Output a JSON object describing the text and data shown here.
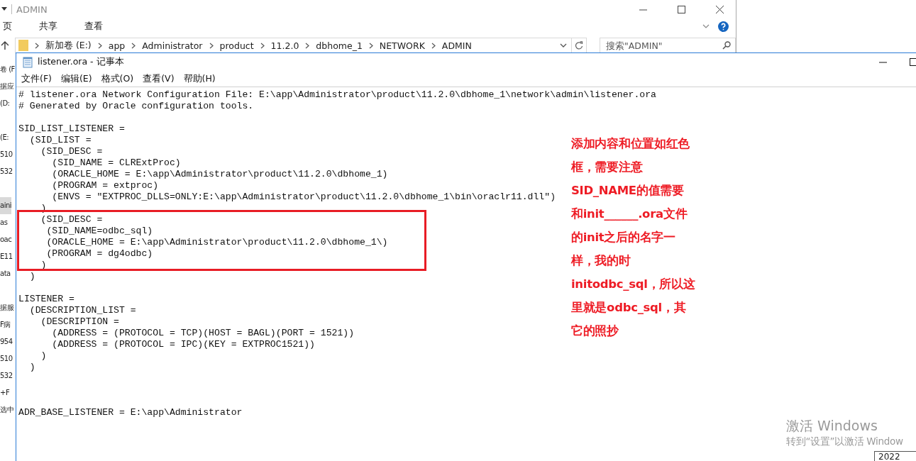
{
  "explorer": {
    "title": "ADMIN",
    "ribbon_tabs": [
      {
        "label": "页",
        "selected": false
      },
      {
        "label": "共享",
        "selected": false
      },
      {
        "label": "查看",
        "selected": false
      }
    ],
    "breadcrumbs": [
      "新加卷 (E:)",
      "app",
      "Administrator",
      "product",
      "11.2.0",
      "dbhome_1",
      "NETWORK",
      "ADMIN"
    ],
    "search": {
      "placeholder": "搜索\"ADMIN\""
    },
    "nav_items": [
      {
        "kind": "item",
        "label": "卷 (F",
        "selected": false
      },
      {
        "kind": "item",
        "label": "据应",
        "selected": false
      },
      {
        "kind": "item",
        "label": "(D:",
        "selected": false
      },
      {
        "kind": "blank"
      },
      {
        "kind": "item",
        "label": "(E:",
        "selected": false
      },
      {
        "kind": "item",
        "label": "510",
        "selected": false
      },
      {
        "kind": "item",
        "label": "532",
        "selected": false
      },
      {
        "kind": "blank"
      },
      {
        "kind": "item",
        "label": "aini",
        "selected": true
      },
      {
        "kind": "item",
        "label": "as",
        "selected": false
      },
      {
        "kind": "item",
        "label": "oac",
        "selected": false
      },
      {
        "kind": "item",
        "label": "E11",
        "selected": false
      },
      {
        "kind": "item",
        "label": "ata",
        "selected": false
      },
      {
        "kind": "blank"
      },
      {
        "kind": "item",
        "label": "据服",
        "selected": false
      },
      {
        "kind": "item",
        "label": "F病",
        "selected": false
      },
      {
        "kind": "item",
        "label": "954",
        "selected": false
      },
      {
        "kind": "item",
        "label": "510",
        "selected": false
      },
      {
        "kind": "item",
        "label": "532",
        "selected": false
      },
      {
        "kind": "item",
        "label": "+F",
        "selected": false
      },
      {
        "kind": "item",
        "label": "选中",
        "selected": false
      }
    ]
  },
  "notepad": {
    "title": "listener.ora - 记事本",
    "menu": [
      "文件(F)",
      "编辑(E)",
      "格式(O)",
      "查看(V)",
      "帮助(H)"
    ],
    "lines": [
      {
        "kind": "text",
        "text": "# listener.ora Network Configuration File: E:\\app\\Administrator\\product\\11.2.0\\dbhome_1\\network\\admin\\listener.ora"
      },
      {
        "kind": "text",
        "text": "# Generated by Oracle configuration tools."
      },
      {
        "kind": "blank"
      },
      {
        "kind": "text",
        "text": "SID_LIST_LISTENER ="
      },
      {
        "kind": "text",
        "text": "  (SID_LIST ="
      },
      {
        "kind": "text",
        "text": "    (SID_DESC ="
      },
      {
        "kind": "text",
        "text": "      (SID_NAME = CLRExtProc)"
      },
      {
        "kind": "text",
        "text": "      (ORACLE_HOME = E:\\app\\Administrator\\product\\11.2.0\\dbhome_1)"
      },
      {
        "kind": "text",
        "text": "      (PROGRAM = extproc)"
      },
      {
        "kind": "text",
        "text": "      (ENVS = \"EXTPROC_DLLS=ONLY:E:\\app\\Administrator\\product\\11.2.0\\dbhome_1\\bin\\oraclr11.dll\")"
      },
      {
        "kind": "text",
        "text": "    )"
      },
      {
        "kind": "text",
        "text": "    (SID_DESC ="
      },
      {
        "kind": "text",
        "text": "     (SID_NAME=odbc_sql)"
      },
      {
        "kind": "text",
        "text": "     (ORACLE_HOME = E:\\app\\Administrator\\product\\11.2.0\\dbhome_1\\)"
      },
      {
        "kind": "text",
        "text": "     (PROGRAM = dg4odbc)"
      },
      {
        "kind": "text",
        "text": "    )"
      },
      {
        "kind": "text",
        "text": "  )"
      },
      {
        "kind": "blank"
      },
      {
        "kind": "text",
        "text": "LISTENER ="
      },
      {
        "kind": "text",
        "text": "  (DESCRIPTION_LIST ="
      },
      {
        "kind": "text",
        "text": "    (DESCRIPTION ="
      },
      {
        "kind": "text",
        "text": "      (ADDRESS = (PROTOCOL = TCP)(HOST = BAGL)(PORT = 1521))"
      },
      {
        "kind": "text",
        "text": "      (ADDRESS = (PROTOCOL = IPC)(KEY = EXTPROC1521))"
      },
      {
        "kind": "text",
        "text": "    )"
      },
      {
        "kind": "text",
        "text": "  )"
      },
      {
        "kind": "blank"
      },
      {
        "kind": "blank"
      },
      {
        "kind": "blank"
      },
      {
        "kind": "text",
        "text": "ADR_BASE_LISTENER = E:\\app\\Administrator"
      }
    ]
  },
  "annotation": {
    "lines": [
      "添加内容和位置如红色",
      "框，需要注意",
      "SID_NAME的值需要",
      "和init______.ora文件",
      "的init之后的名字一",
      "样，我的时",
      "initodbc_sql，所以这",
      "里就是odbc_sql，其",
      "它的照抄"
    ]
  },
  "activation": {
    "title": "激活 Windows",
    "subtitle": "转到“设置”以激活 Window"
  },
  "taskbar": {
    "clock": "2022"
  }
}
